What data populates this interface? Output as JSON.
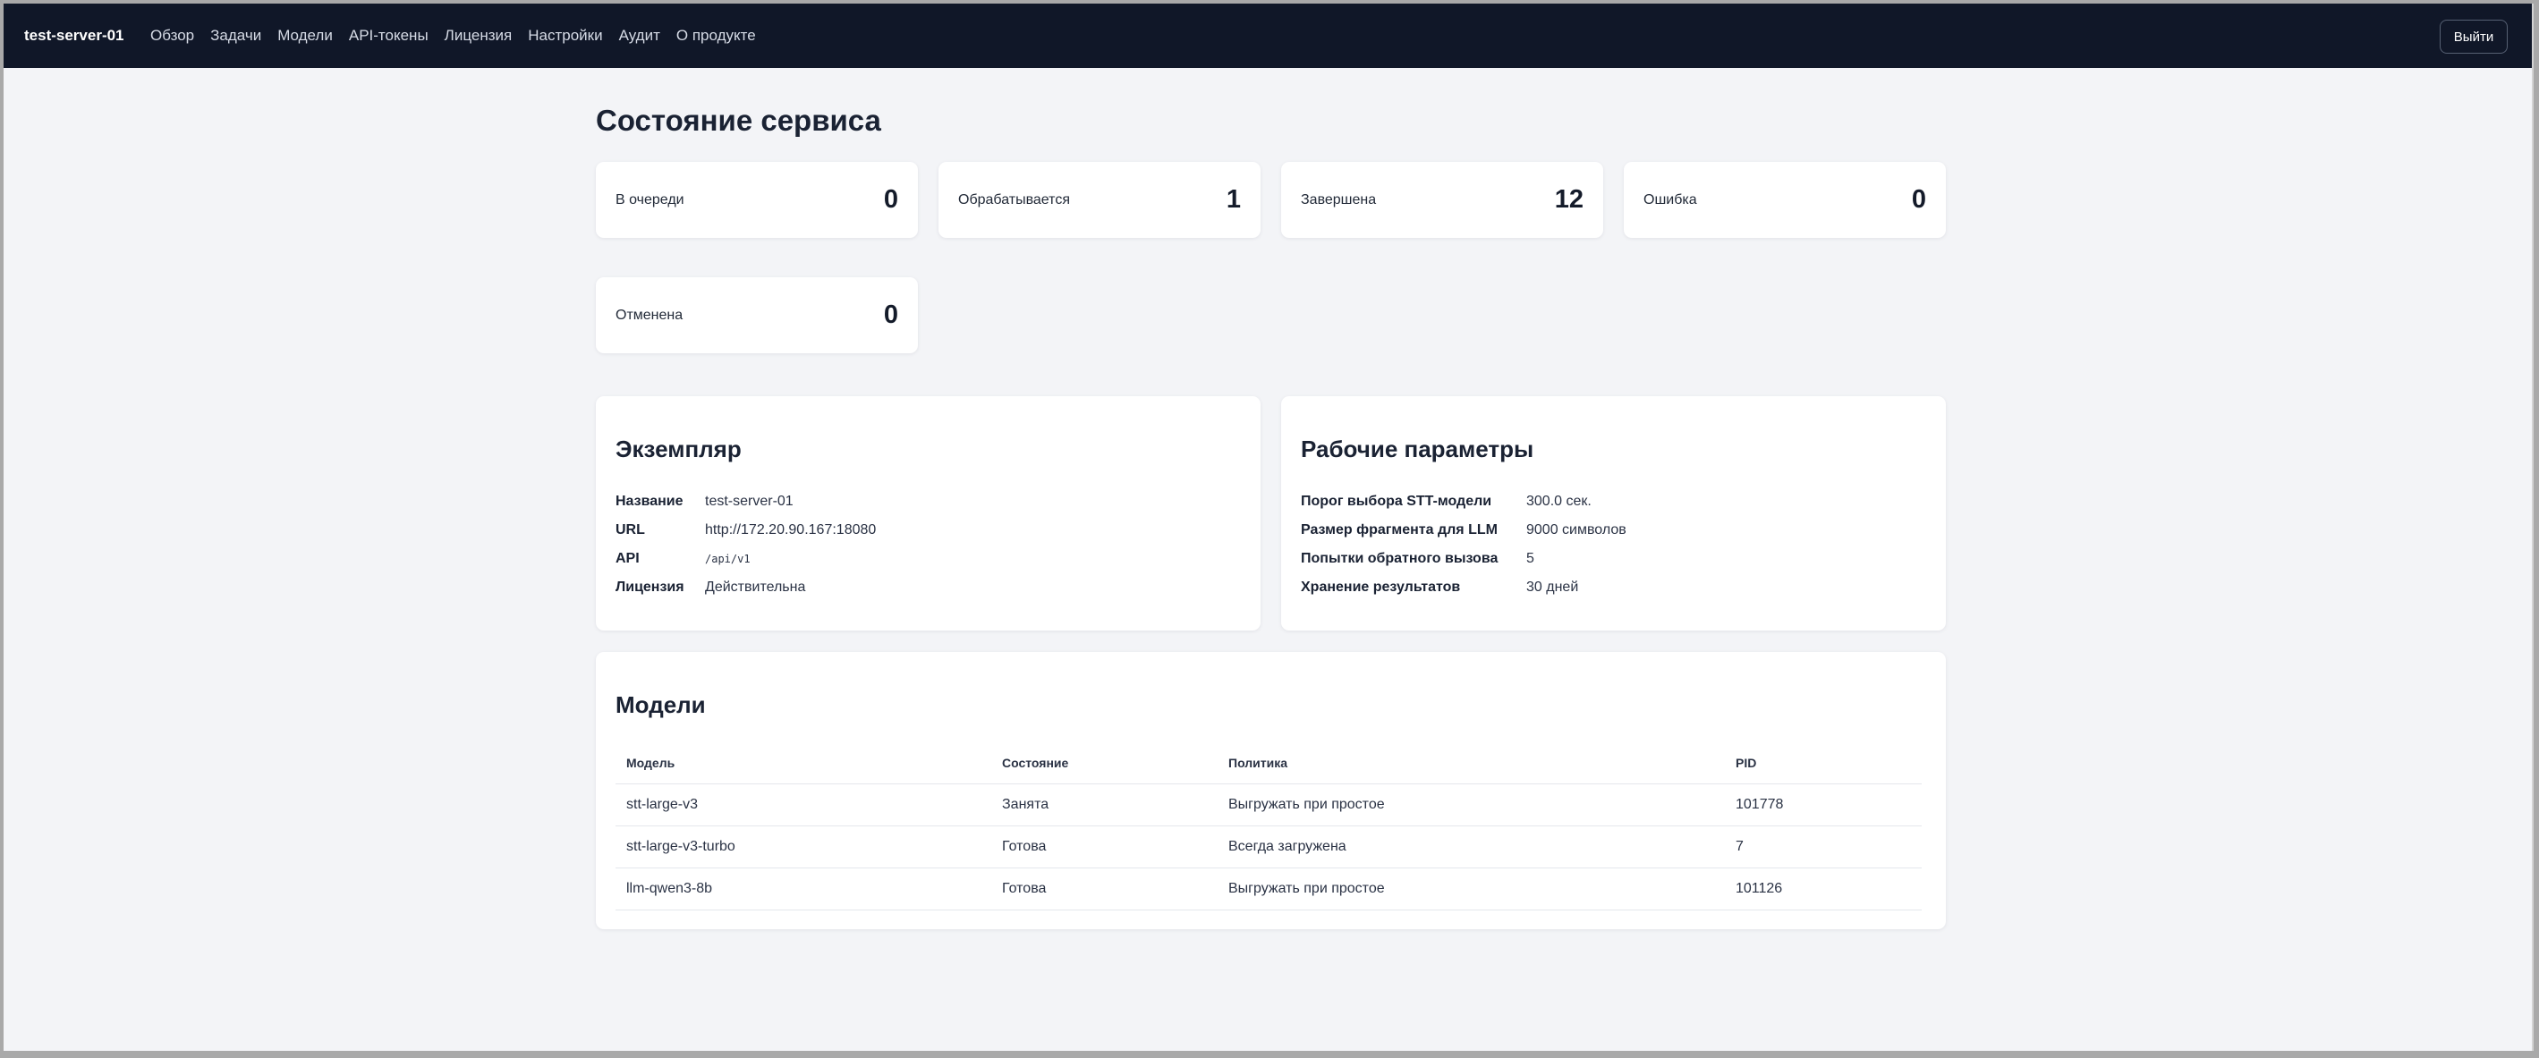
{
  "navbar": {
    "brand": "test-server-01",
    "links": [
      "Обзор",
      "Задачи",
      "Модели",
      "API-токены",
      "Лицензия",
      "Настройки",
      "Аудит",
      "О продукте"
    ],
    "logout_label": "Выйти"
  },
  "page_title": "Состояние сервиса",
  "stats": [
    {
      "label": "В очереди",
      "value": "0"
    },
    {
      "label": "Обрабатывается",
      "value": "1"
    },
    {
      "label": "Завершена",
      "value": "12"
    },
    {
      "label": "Ошибка",
      "value": "0"
    },
    {
      "label": "Отменена",
      "value": "0"
    }
  ],
  "instance": {
    "title": "Экземпляр",
    "rows": [
      {
        "key": "Название",
        "value": "test-server-01"
      },
      {
        "key": "URL",
        "value": "http://172.20.90.167:18080"
      },
      {
        "key": "API",
        "value": "/api/v1"
      },
      {
        "key": "Лицензия",
        "value": "Действительна"
      }
    ]
  },
  "params": {
    "title": "Рабочие параметры",
    "rows": [
      {
        "key": "Порог выбора STT-модели",
        "value": "300.0 сек."
      },
      {
        "key": "Размер фрагмента для LLM",
        "value": "9000 символов"
      },
      {
        "key": "Попытки обратного вызова",
        "value": "5"
      },
      {
        "key": "Хранение результатов",
        "value": "30 дней"
      }
    ]
  },
  "models": {
    "title": "Модели",
    "columns": [
      "Модель",
      "Состояние",
      "Политика",
      "PID"
    ],
    "rows": [
      [
        "stt-large-v3",
        "Занята",
        "Выгружать при простое",
        "101778"
      ],
      [
        "stt-large-v3-turbo",
        "Готова",
        "Всегда загружена",
        "7"
      ],
      [
        "llm-qwen3-8b",
        "Готова",
        "Выгружать при простое",
        "101126"
      ]
    ]
  }
}
